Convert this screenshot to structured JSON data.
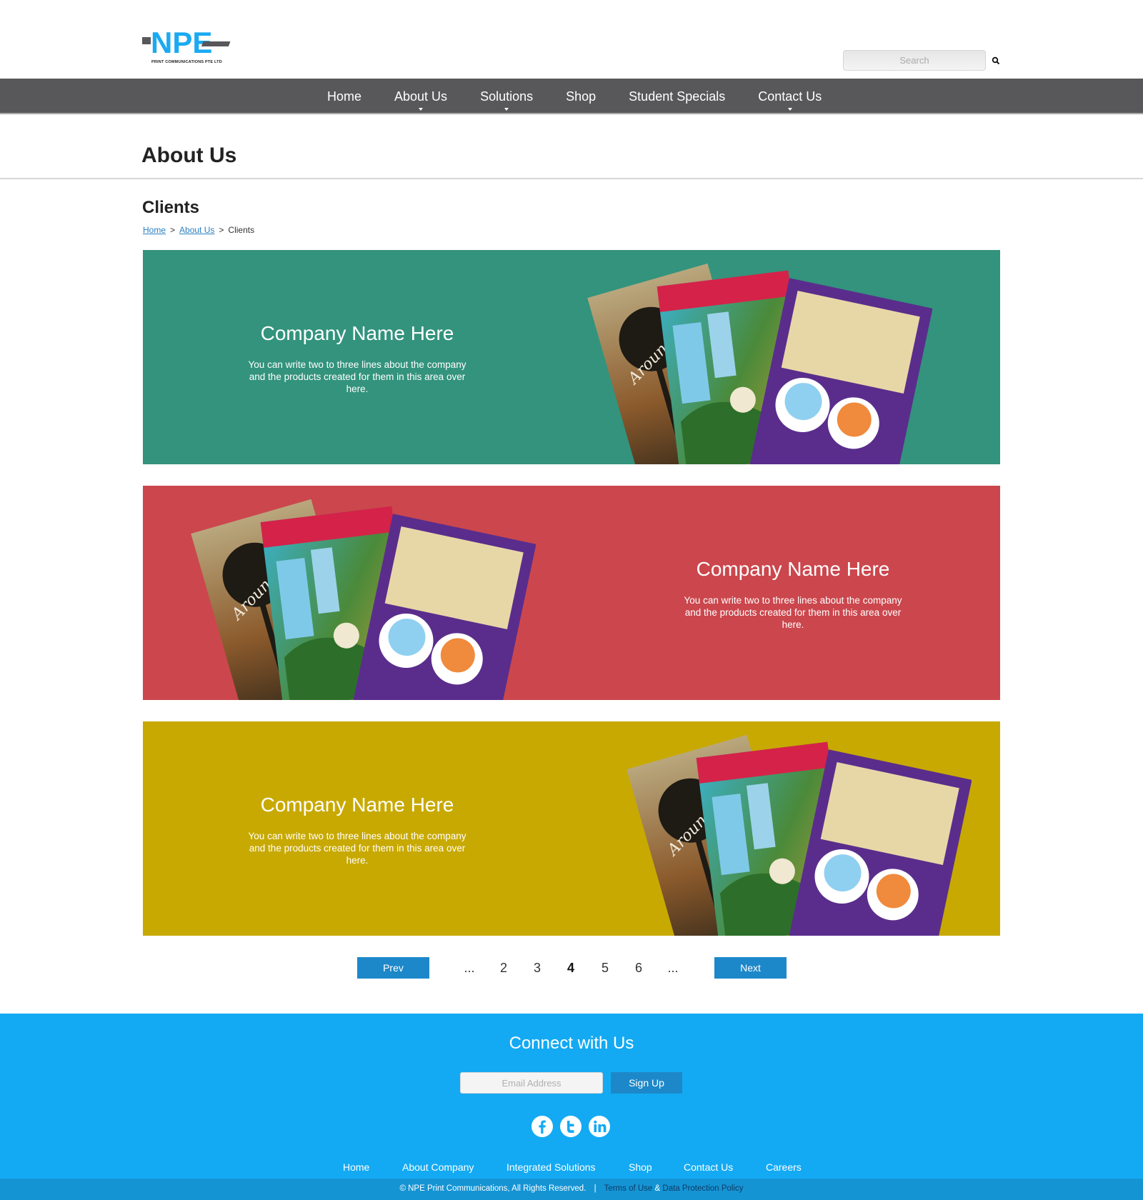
{
  "brand": {
    "logo_text": "NPE",
    "logo_subtitle": "PRINT COMMUNICATIONS PTE LTD",
    "primary_color": "#1aaaf2",
    "dark_color": "#58585a"
  },
  "search": {
    "placeholder": "Search"
  },
  "nav": {
    "items": [
      {
        "label": "Home",
        "dropdown": false
      },
      {
        "label": "About Us",
        "dropdown": true
      },
      {
        "label": "Solutions",
        "dropdown": true
      },
      {
        "label": "Shop",
        "dropdown": false
      },
      {
        "label": "Student Specials",
        "dropdown": false
      },
      {
        "label": "Contact Us",
        "dropdown": true
      }
    ]
  },
  "page": {
    "title": "About Us",
    "section_title": "Clients",
    "breadcrumb": [
      "Home",
      "About Us",
      "Clients"
    ]
  },
  "clients": [
    {
      "name": "Company Name Here",
      "description": "You can write two to three lines about the company and the products created for them in this area over here.",
      "color": "#33937d",
      "image_side": "right"
    },
    {
      "name": "Company Name Here",
      "description": "You can write two to three lines about the company and the products created for them in this area over here.",
      "color": "#cb474d",
      "image_side": "left"
    },
    {
      "name": "Company Name Here",
      "description": "You can write two to three lines about the company and the products created for them in this area over here.",
      "color": "#c8a901",
      "image_side": "right"
    }
  ],
  "pagination": {
    "prev_label": "Prev",
    "next_label": "Next",
    "ellipsis": "...",
    "pages": [
      "2",
      "3",
      "4",
      "5",
      "6"
    ],
    "current": "4"
  },
  "footer": {
    "title": "Connect with Us",
    "email_placeholder": "Email Address",
    "signup_label": "Sign Up",
    "social": [
      "facebook-icon",
      "twitter-icon",
      "linkedin-icon"
    ],
    "links": [
      "Home",
      "About Company",
      "Integrated Solutions",
      "Shop",
      "Contact Us",
      "Careers"
    ],
    "copyright": "© NPE Print Communications, All Rights Reserved.",
    "separator": "|",
    "terms": "Terms of Use",
    "ampersand": "&",
    "privacy": "Data Protection Policy"
  }
}
